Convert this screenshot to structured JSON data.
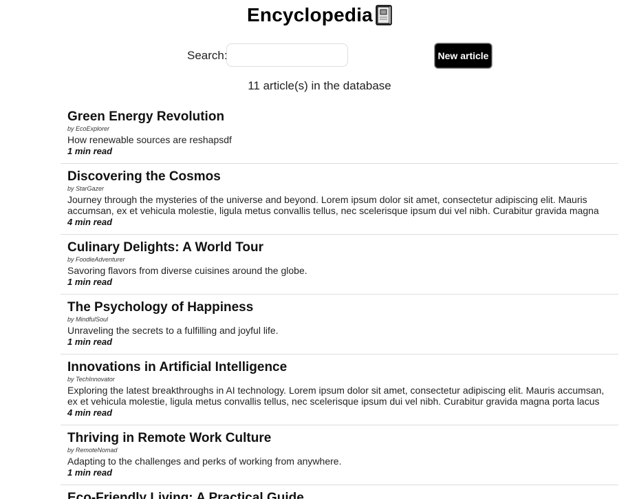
{
  "header": {
    "title": "Encyclopedia"
  },
  "search": {
    "label": "Search:",
    "value": "",
    "placeholder": ""
  },
  "toolbar": {
    "new_article_label": "New article"
  },
  "stats": {
    "article_count_text": "11 article(s) in the database"
  },
  "articles": [
    {
      "title": "Green Energy Revolution",
      "author": "by EcoExplorer",
      "summary": "How renewable sources are reshapsdf",
      "read_time": "1 min read"
    },
    {
      "title": "Discovering the Cosmos",
      "author": "by StarGazer",
      "summary": "Journey through the mysteries of the universe and beyond. Lorem ipsum dolor sit amet, consectetur adipiscing elit. Mauris accumsan, ex et vehicula molestie, ligula metus convallis tellus, nec scelerisque ipsum dui vel nibh. Curabitur gravida magna porta lacus molestie, vitae lobortis mi dignissim. Donec cursus odio ut tincidunt molestie. Maecenas ac ligula libero. Pellentesque",
      "read_time": "4 min read"
    },
    {
      "title": "Culinary Delights: A World Tour",
      "author": "by FoodieAdventurer",
      "summary": "Savoring flavors from diverse cuisines around the globe.",
      "read_time": "1 min read"
    },
    {
      "title": "The Psychology of Happiness",
      "author": "by MindfulSoul",
      "summary": "Unraveling the secrets to a fulfilling and joyful life.",
      "read_time": "1 min read"
    },
    {
      "title": "Innovations in Artificial Intelligence",
      "author": "by TechInnovator",
      "summary": "Exploring the latest breakthroughs in AI technology. Lorem ipsum dolor sit amet, consectetur adipiscing elit. Mauris accumsan, ex et vehicula molestie, ligula metus convallis tellus, nec scelerisque ipsum dui vel nibh. Curabitur gravida magna porta lacus molestie, vitae lobortis mi dignissim. Donec cursus odio ut tincidunt molestie. Maecenas ac ligula libero. Pellentesque sit amet",
      "read_time": "4 min read"
    },
    {
      "title": "Thriving in Remote Work Culture",
      "author": "by RemoteNomad",
      "summary": "Adapting to the challenges and perks of working from anywhere.",
      "read_time": "1 min read"
    },
    {
      "title": "Eco-Friendly Living: A Practical Guide",
      "author": "",
      "summary": "",
      "read_time": ""
    }
  ]
}
